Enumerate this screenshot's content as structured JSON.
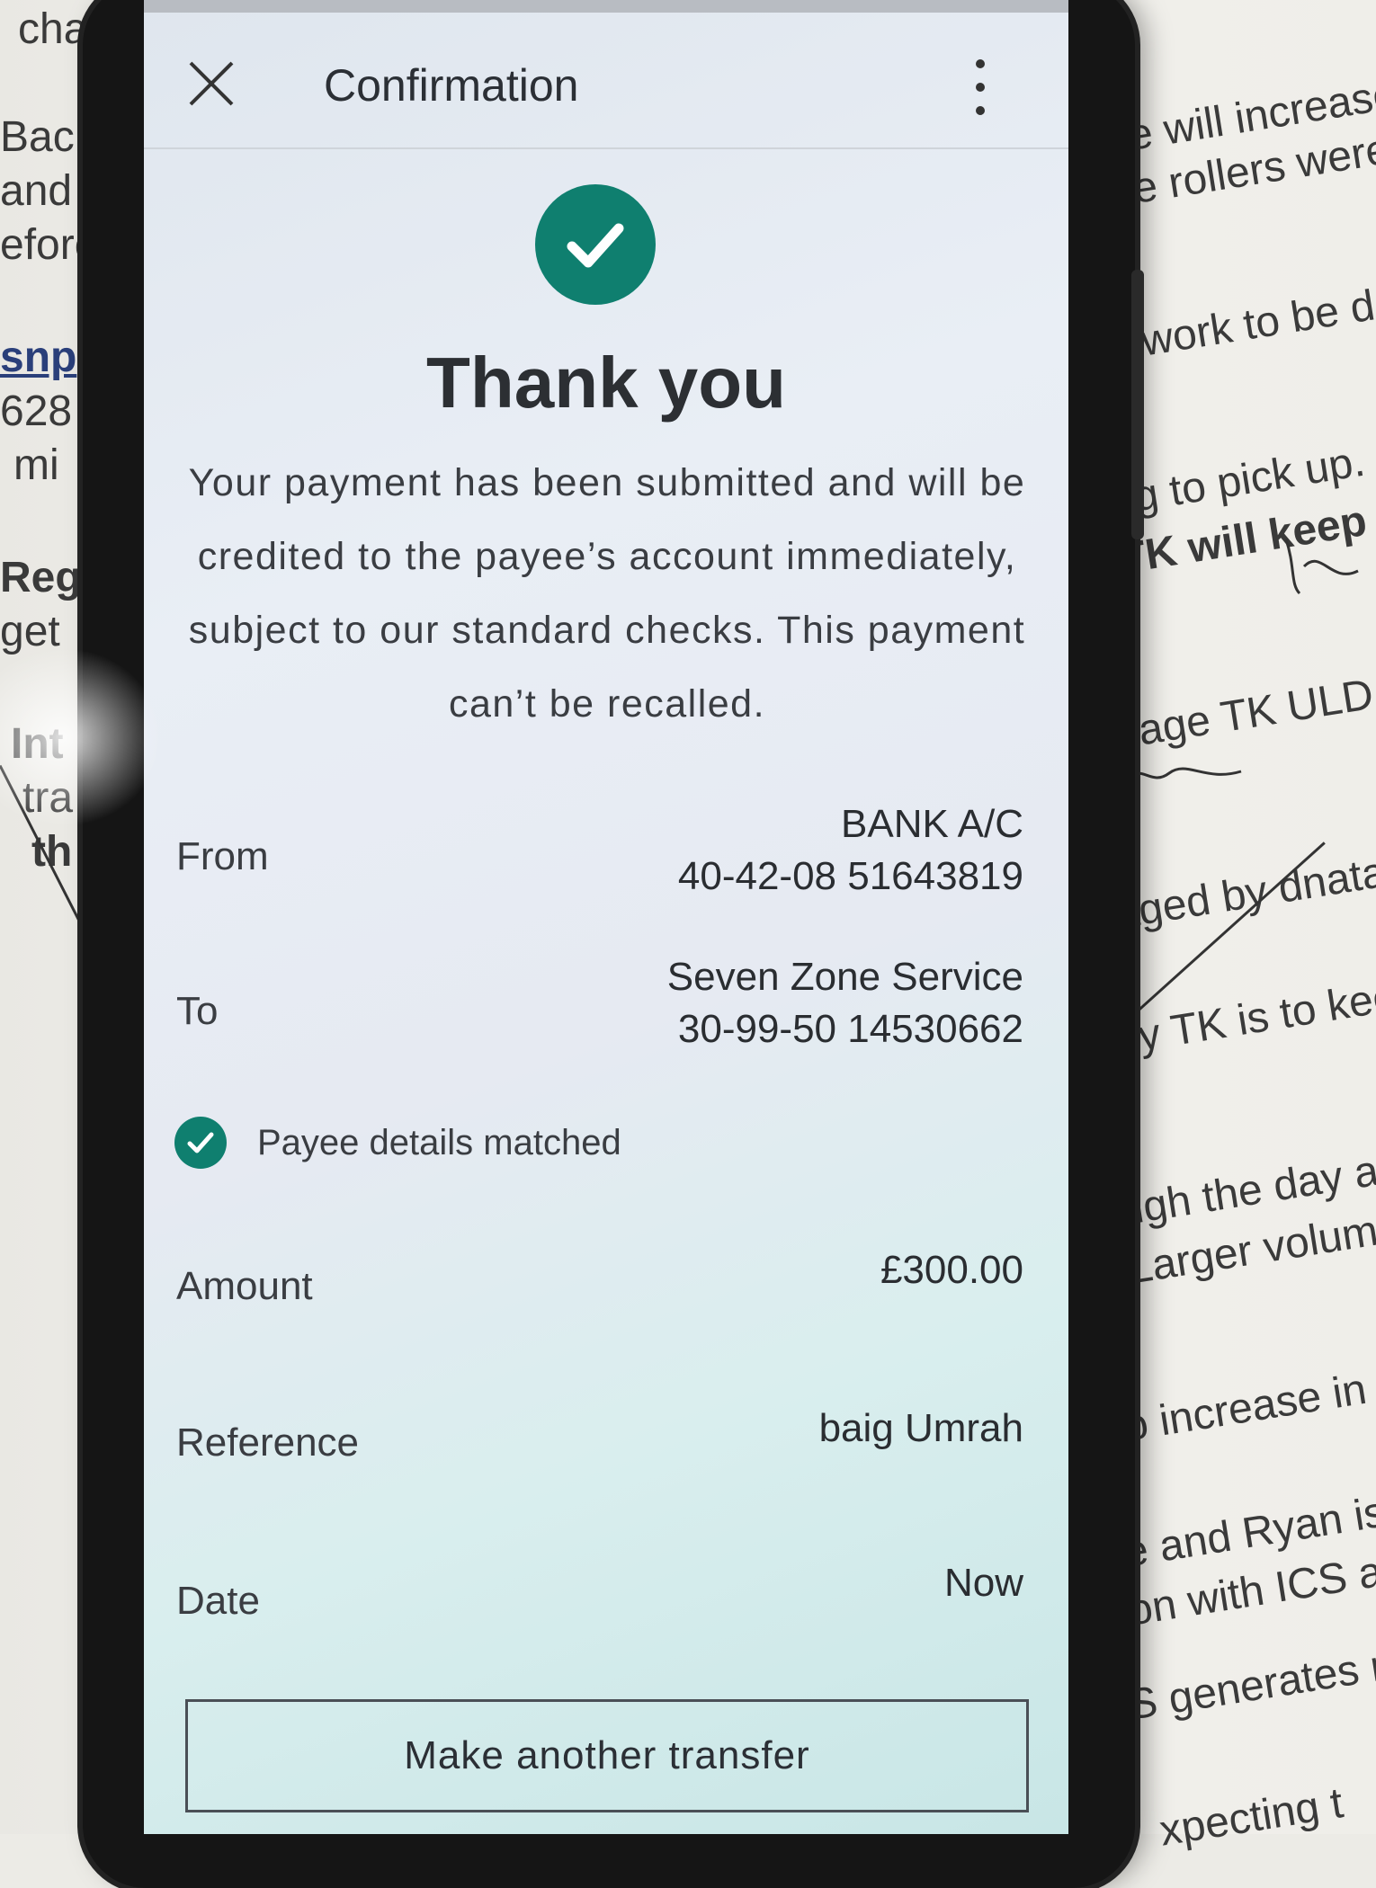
{
  "background_paper": {
    "left": [
      "cha",
      "Back",
      "and",
      "efore",
      "snp",
      "628",
      "mi",
      "Regi",
      "get",
      "Int",
      "tra",
      "th"
    ],
    "right": [
      "ide will increase",
      "ere rollers were",
      "ill work to be d",
      "ng to pick up.",
      "TK will keep",
      "nage TK ULD a",
      "aged by dnata",
      "by TK is to kee",
      "ugh the day as",
      "Larger volume",
      "o increase in",
      "e and Ryan is",
      "on with ICS a",
      "S generates n",
      "xpecting t"
    ]
  },
  "header": {
    "title": "Confirmation"
  },
  "confirmation": {
    "headline": "Thank you",
    "message": "Your payment has been submitted and will be credited to the payee’s account immediately, subject to our standard checks. This payment can’t be recalled."
  },
  "details": {
    "from_label": "From",
    "from_name": "BANK A/C",
    "from_account": "40-42-08 51643819",
    "to_label": "To",
    "to_name": "Seven Zone Service",
    "to_account": "30-99-50 14530662",
    "payee_matched": "Payee details matched",
    "amount_label": "Amount",
    "amount_value": "£300.00",
    "reference_label": "Reference",
    "reference_value": "baig Umrah",
    "date_label": "Date",
    "date_value": "Now"
  },
  "actions": {
    "transfer_button": "Make another transfer"
  },
  "colors": {
    "accent": "#0f7f6f"
  }
}
